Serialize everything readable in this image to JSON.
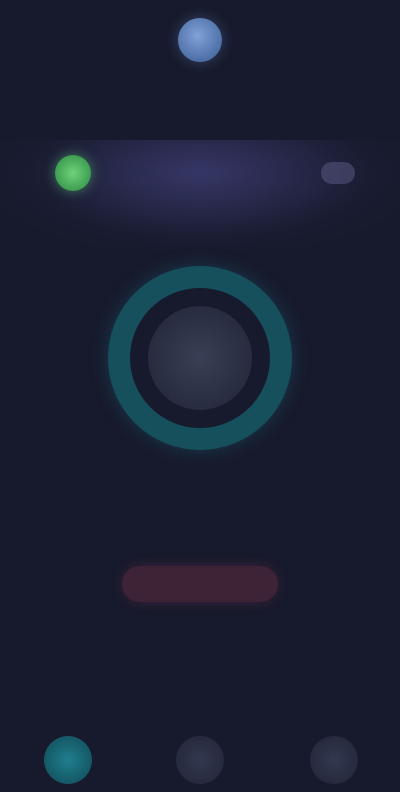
{
  "header": {
    "subtitle": ""
  },
  "status": {
    "label": "",
    "detail": ""
  },
  "meter": {
    "value": "",
    "caption": ""
  },
  "actions": {
    "disconnect_label": ""
  },
  "tabs": [
    {
      "icon": "shield-icon",
      "glyph": "●",
      "active": true
    },
    {
      "icon": "chart-icon",
      "glyph": "●",
      "active": false
    },
    {
      "icon": "gear-icon",
      "glyph": "●",
      "active": false
    }
  ],
  "colors": {
    "background": "#171a2c",
    "accent": "#1f7f8e",
    "status_ok": "#6fd27a",
    "danger": "#a23c5a"
  }
}
